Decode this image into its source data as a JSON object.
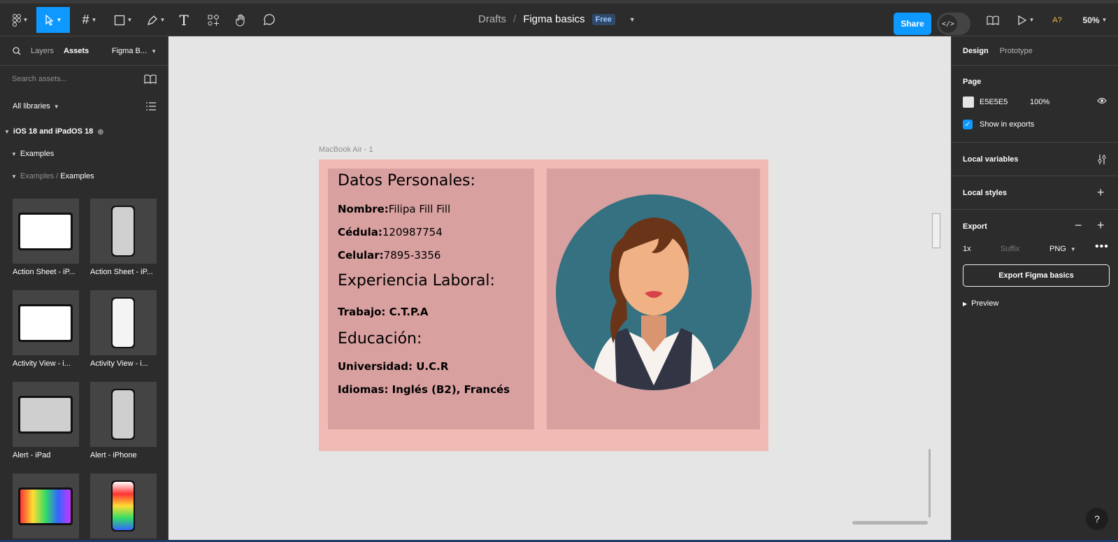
{
  "toolbar": {
    "title_drafts": "Drafts",
    "title_sep": "/",
    "title_file": "Figma basics",
    "badge": "Free",
    "share": "Share",
    "dev_mode_icon": "</>",
    "ai_label": "A?",
    "zoom": "50%"
  },
  "left_panel": {
    "tab_layers": "Layers",
    "tab_assets": "Assets",
    "library_select": "Figma B...",
    "search_placeholder": "Search assets...",
    "all_libraries": "All libraries",
    "library_name": "iOS 18 and iPadOS 18",
    "group": "Examples",
    "path_parent": "Examples",
    "path_sep": "/",
    "path_child": "Examples",
    "thumbs": [
      {
        "label": "Action Sheet - iP..."
      },
      {
        "label": "Action Sheet - iP..."
      },
      {
        "label": "Activity View - i..."
      },
      {
        "label": "Activity View - i..."
      },
      {
        "label": "Alert - iPad"
      },
      {
        "label": "Alert - iPhone"
      },
      {
        "label": ""
      },
      {
        "label": ""
      }
    ]
  },
  "canvas": {
    "frame_label": "MacBook Air - 1",
    "cv": {
      "h_personal": "Datos Personales:",
      "nombre_label": "Nombre:",
      "nombre_value": "Filipa Fill Fill",
      "cedula_label": "Cédula:",
      "cedula_value": "120987754",
      "celular_label": "Celular:",
      "celular_value": "7895-3356",
      "h_experience": "Experiencia Laboral:",
      "trabajo": "Trabajo: C.T.P.A",
      "h_education": "Educación:",
      "universidad": "Universidad: U.C.R",
      "idiomas": "Idiomas: Inglés (B2), Francés"
    }
  },
  "right_panel": {
    "tab_design": "Design",
    "tab_prototype": "Prototype",
    "page_title": "Page",
    "page_color": "E5E5E5",
    "page_opacity": "100%",
    "show_in_exports": "Show in exports",
    "local_variables": "Local variables",
    "local_styles": "Local styles",
    "export_title": "Export",
    "export_scale": "1x",
    "export_suffix_placeholder": "Suffix",
    "export_format": "PNG",
    "export_button": "Export Figma basics",
    "preview": "Preview",
    "help": "?"
  },
  "colors": {
    "accent": "#0d99ff",
    "canvas": "#e5e5e5",
    "frame_bg": "#f0bbb5",
    "card_bg": "#d9a0a0",
    "avatar_circle": "#357180"
  }
}
